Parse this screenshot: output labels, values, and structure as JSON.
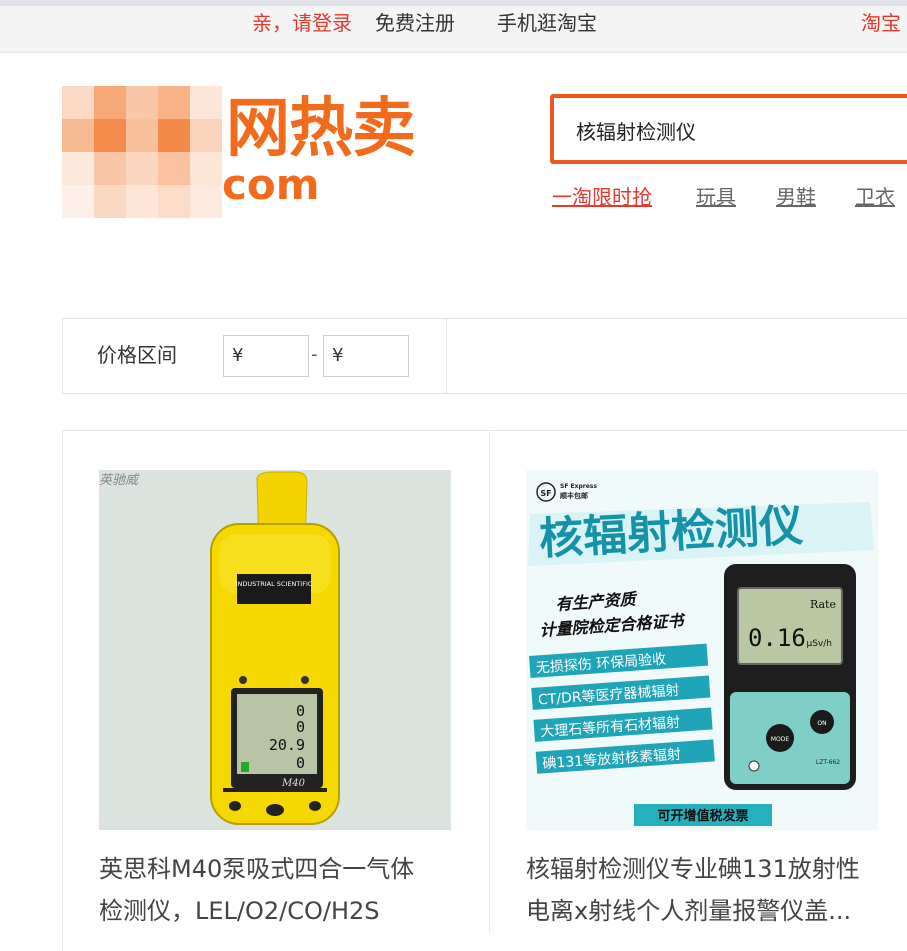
{
  "topbar": {
    "login": "亲，请登录",
    "register": "免费注册",
    "mobile": "手机逛淘宝",
    "taobao": "淘宝"
  },
  "logo": {
    "main": "网热卖",
    "com": "com"
  },
  "search": {
    "value": "核辐射检测仪"
  },
  "hot_words": [
    "一淘限时抢",
    "玩具",
    "男鞋",
    "卫衣"
  ],
  "filter": {
    "price_label": "价格区间",
    "min": "¥",
    "dash": "-",
    "max": "¥"
  },
  "products": [
    {
      "image_label": "英驰威",
      "device_brand": "INDUSTRIAL SCIENTIFIC",
      "device_readings": [
        "0",
        "0",
        "20.9",
        "0"
      ],
      "device_model": "M40",
      "title_line1": "英思科M40泵吸式四合一气体",
      "title_line2": "检测仪，LEL/O2/CO/H2S"
    },
    {
      "badge_sf": "SF",
      "badge_text1": "SF Express",
      "badge_text2": "顺丰包邮",
      "banner": "核辐射检测仪",
      "line1": "有生产资质",
      "line2": "计量院检定合格证书",
      "feature1": "无损探伤 环保局验收",
      "feature2": "CT/DR等医疗器械辐射",
      "feature3": "大理石等所有石材辐射",
      "feature4": "碘131等放射核素辐射",
      "screen_rate": "Rate",
      "screen_value": "0.16",
      "screen_unit": "μSv/h",
      "button_mode": "MODE",
      "button_on": "ON",
      "model_label": "LZT-662",
      "invoice": "可开增值税发票",
      "title_line1": "核辐射检测仪专业碘131放射性",
      "title_line2": "电离x射线个人剂量报警仪盖..."
    }
  ],
  "colors": {
    "brand_orange": "#f26b1d",
    "accent_red": "#e4392d",
    "search_border": "#e85a1f",
    "device_yellow": "#f5d800",
    "banner_blue": "#1493a8"
  }
}
